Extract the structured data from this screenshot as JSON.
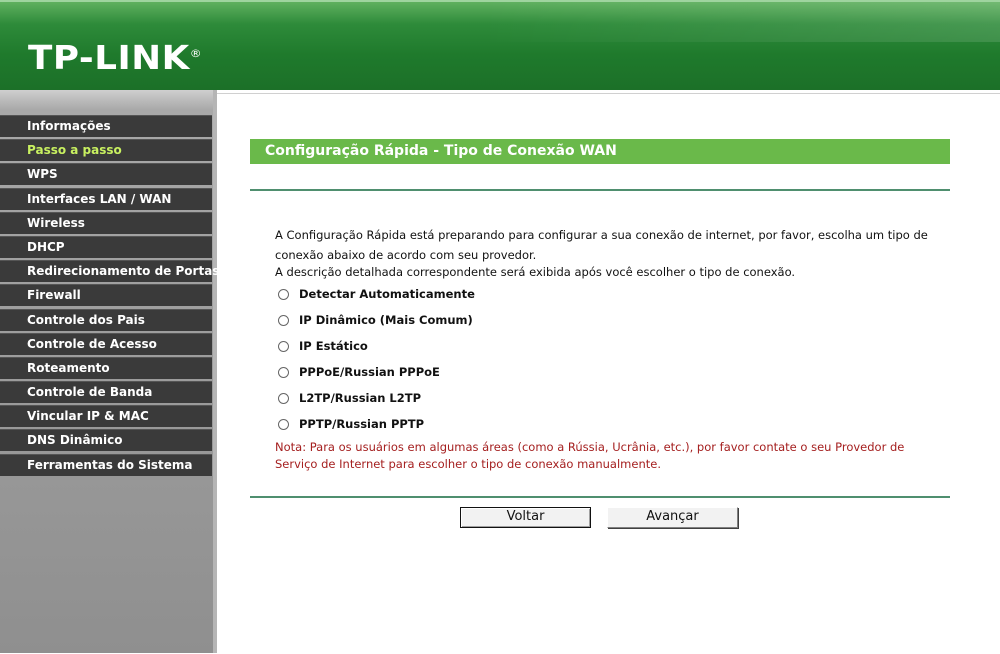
{
  "header": {
    "logo_text": "TP-LINK",
    "logo_mark": "®"
  },
  "sidebar": {
    "items": [
      {
        "label": "Informações",
        "active": false
      },
      {
        "label": "Passo a passo",
        "active": true
      },
      {
        "label": "WPS",
        "active": false
      },
      {
        "label": "Interfaces LAN / WAN",
        "active": false
      },
      {
        "label": "Wireless",
        "active": false
      },
      {
        "label": "DHCP",
        "active": false
      },
      {
        "label": "Redirecionamento de Portas",
        "active": false
      },
      {
        "label": "Firewall",
        "active": false
      },
      {
        "label": "Controle dos Pais",
        "active": false
      },
      {
        "label": "Controle de Acesso",
        "active": false
      },
      {
        "label": "Roteamento",
        "active": false
      },
      {
        "label": "Controle de Banda",
        "active": false
      },
      {
        "label": "Vincular IP & MAC",
        "active": false
      },
      {
        "label": "DNS Dinâmico",
        "active": false
      },
      {
        "label": "Ferramentas do Sistema",
        "active": false
      }
    ]
  },
  "main": {
    "title": "Configuração Rápida - Tipo de Conexão WAN",
    "description_1": "A Configuração Rápida está preparando para configurar a sua conexão de internet, por favor, escolha um tipo de conexão abaixo de acordo com seu provedor.",
    "description_2": "A descrição detalhada correspondente será exibida após você escolher o tipo de conexão.",
    "options": [
      {
        "label": "Detectar Automaticamente",
        "selected": false
      },
      {
        "label": "IP Dinâmico (Mais Comum)",
        "selected": false
      },
      {
        "label": "IP Estático",
        "selected": false
      },
      {
        "label": "PPPoE/Russian PPPoE",
        "selected": false
      },
      {
        "label": "L2TP/Russian L2TP",
        "selected": false
      },
      {
        "label": "PPTP/Russian PPTP",
        "selected": false
      }
    ],
    "note": "Nota: Para os usuários em algumas áreas (como a Rússia, Ucrânia, etc.), por favor contate o seu Provedor de Serviço de Internet para escolher o tipo de conexão manualmente.",
    "back_label": "Voltar",
    "next_label": "Avançar"
  },
  "colors": {
    "header_green": "#1f7a2c",
    "title_bar_green": "#6ab94a",
    "nav_bg": "#3a3a3a",
    "nav_active_text": "#c8f060",
    "note_red": "#a52020"
  }
}
